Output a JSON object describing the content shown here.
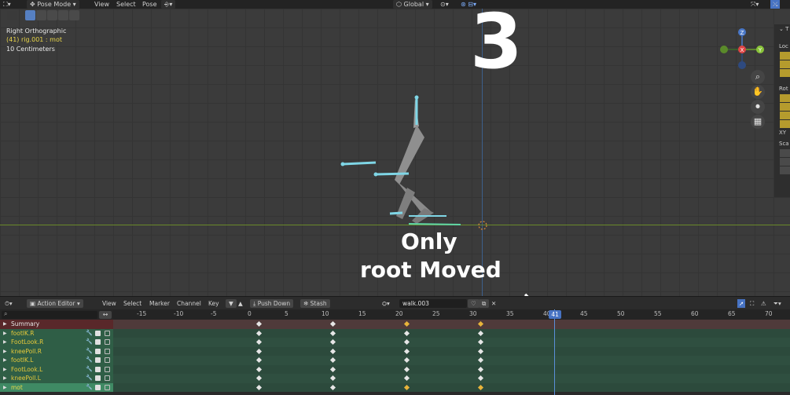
{
  "header": {
    "mode": "Pose Mode",
    "menu": [
      "View",
      "Select",
      "Pose"
    ],
    "orientation": "Global"
  },
  "viewport": {
    "view_name": "Right Orthographic",
    "object_info": "(41) rig.001 : mot",
    "scale": "10 Centimeters",
    "gizmo_axes": {
      "z": "Z",
      "x": "X",
      "y": "Y"
    },
    "nav_icons": [
      "zoom-icon",
      "hand-icon",
      "camera-icon",
      "grid-icon"
    ],
    "npanel_labels": [
      "Loc",
      "Rot",
      "XY",
      "Sca"
    ]
  },
  "annotations": {
    "number": "3",
    "note_line1": "Only",
    "note_line2": "root Moved",
    "arrow": "↘"
  },
  "dopesheet": {
    "editor": "Action Editor",
    "menu": [
      "View",
      "Select",
      "Marker",
      "Channel",
      "Key"
    ],
    "push_down": "Push Down",
    "stash": "Stash",
    "action_name": "walk.003",
    "current_frame": "41",
    "ruler": [
      "-15",
      "-10",
      "-5",
      "0",
      "5",
      "10",
      "15",
      "20",
      "25",
      "30",
      "35",
      "40",
      "45",
      "50",
      "55",
      "60",
      "65",
      "70"
    ],
    "channels": [
      "Summary",
      "footIK.R",
      "FootLook.R",
      "kneePoll.R",
      "footIK.L",
      "FootLook.L",
      "kneePoll.L",
      "mot"
    ]
  },
  "colors": {
    "accent": "#4773c3",
    "summary": "#59282a",
    "channel": "#2f5e46",
    "keyframe": "#e6e6e6",
    "keyframe_selected": "#e8b43a"
  }
}
